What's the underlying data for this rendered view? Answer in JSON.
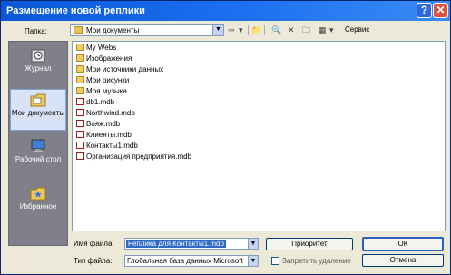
{
  "window": {
    "title": "Размещение новой реплики"
  },
  "titlebar": {
    "help_label": "?",
    "close_label": "✕"
  },
  "lookin": {
    "label": "Папка:",
    "value": "Мои документы"
  },
  "toolbar": {
    "service_label": "Сервис"
  },
  "places": [
    {
      "label": "Журнал",
      "icon": "history-icon"
    },
    {
      "label": "Мои документы",
      "icon": "my-documents-icon"
    },
    {
      "label": "Рабочий стол",
      "icon": "desktop-icon"
    },
    {
      "label": "Избранное",
      "icon": "favorites-icon"
    }
  ],
  "files": [
    {
      "name": "My Webs",
      "type": "folder"
    },
    {
      "name": "Изображения",
      "type": "folder"
    },
    {
      "name": "Мои источники данных",
      "type": "folder"
    },
    {
      "name": "Мои рисунки",
      "type": "folder"
    },
    {
      "name": "Моя музыка",
      "type": "folder"
    },
    {
      "name": "db1.mdb",
      "type": "mdb"
    },
    {
      "name": "Northwind.mdb",
      "type": "mdb"
    },
    {
      "name": "Вояж.mdb",
      "type": "mdb"
    },
    {
      "name": "Клиенты.mdb",
      "type": "mdb"
    },
    {
      "name": "Контакты1.mdb",
      "type": "mdb"
    },
    {
      "name": "Организация предприятия.mdb",
      "type": "mdb"
    }
  ],
  "filename": {
    "label": "Имя файла:",
    "value": "Реплика для Контакты1.mdb"
  },
  "filetype": {
    "label": "Тип файла:",
    "value": "Глобальная база данных Microsoft"
  },
  "buttons": {
    "advanced": "Приоритет",
    "ok": "ОК",
    "cancel": "Отмена"
  },
  "readonly": {
    "label": "Запретить удаление"
  },
  "colors": {
    "title_bar": "#1a6ef0",
    "dialog_bg": "#ece9d8",
    "places_bg": "#80808b",
    "selection": "#316ac5"
  }
}
